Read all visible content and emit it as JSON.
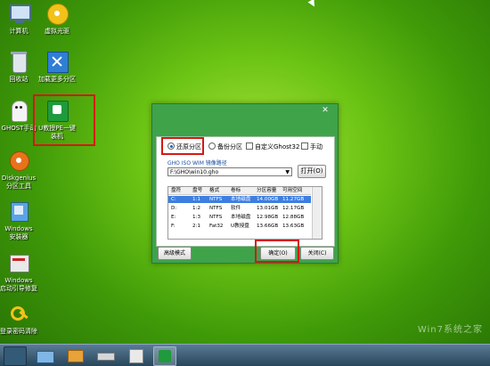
{
  "desktop": {
    "icons": [
      {
        "label": "计算机"
      },
      {
        "label": "虚拟光驱"
      },
      {
        "label": "回收站"
      },
      {
        "label": "加载更多分区"
      },
      {
        "label": "GHOST手动"
      },
      {
        "label": "U教授PE一键",
        "label2": "装机"
      },
      {
        "label": "Diskgenius",
        "label2": "分区工具"
      },
      {
        "label": "Windows",
        "label2": "安装器"
      },
      {
        "label": "Windows",
        "label2": "启动引导修复"
      },
      {
        "label": "登录密码清除"
      }
    ]
  },
  "dialog": {
    "options": {
      "restore": "还原分区",
      "backup": "备份分区",
      "custom": "自定义Ghost32",
      "manual": "手动"
    },
    "path_label": "GHO ISO WIM 镜像路径",
    "path_value": "F:\\GHO\\win10.gho",
    "open_button": "打开(O)",
    "table": {
      "headers": [
        "盘符",
        "盘号",
        "格式",
        "卷标",
        "分区容量",
        "可用空间"
      ],
      "rows": [
        [
          "C:",
          "1:1",
          "NTFS",
          "本地磁盘",
          "14.00GB",
          "11.27GB"
        ],
        [
          "D:",
          "1:2",
          "NTFS",
          "软件",
          "13.01GB",
          "12.17GB"
        ],
        [
          "E:",
          "1:3",
          "NTFS",
          "本地磁盘",
          "12.98GB",
          "12.88GB"
        ],
        [
          "F:",
          "2:1",
          "Fat32",
          "U教授盘",
          "13.66GB",
          "13.63GB"
        ]
      ]
    },
    "advanced_button": "高级模式",
    "confirm_button": "确定(O)",
    "close_button": "关闭(C)"
  },
  "watermark": "Win7系统之家"
}
